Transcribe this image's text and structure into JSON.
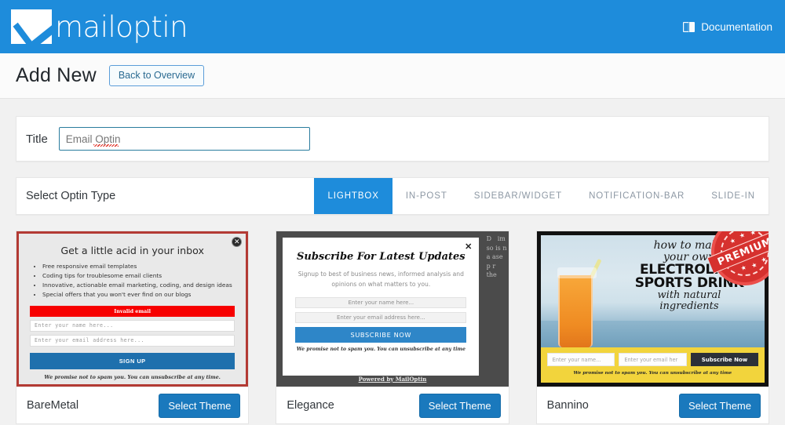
{
  "topbar": {
    "brand_name": "mailoptin",
    "brand_icon": "envelope-check-icon",
    "doc_icon": "book-icon",
    "doc_label": "Documentation",
    "bg_color": "#1e8cdb"
  },
  "pagehead": {
    "title": "Add New",
    "back_button": "Back to Overview"
  },
  "title_panel": {
    "label": "Title",
    "value": "Email Optin",
    "placeholder": "Email Optin"
  },
  "type_panel": {
    "label": "Select Optin Type",
    "tabs": [
      {
        "label": "LIGHTBOX",
        "active": true
      },
      {
        "label": "IN-POST",
        "active": false
      },
      {
        "label": "SIDEBAR/WIDGET",
        "active": false
      },
      {
        "label": "NOTIFICATION-BAR",
        "active": false
      },
      {
        "label": "SLIDE-IN",
        "active": false
      }
    ],
    "active_color": "#1e8cdb"
  },
  "themes": [
    {
      "name": "BareMetal",
      "select_label": "Select Theme",
      "premium": false,
      "preview": {
        "close_icon": "close-circle-icon",
        "headline": "Get a little acid in your inbox",
        "bullets": [
          "Free responsive email templates",
          "Coding tips for troublesome email clients",
          "Innovative, actionable email marketing, coding, and design ideas",
          "Special offers that you won't ever find on our blogs"
        ],
        "error": "Invalid email",
        "name_placeholder": "Enter your name here...",
        "email_placeholder": "Enter your email address here...",
        "button": "SIGN UP",
        "note": "We promise not to spam you. You can unsubscribe at any time."
      }
    },
    {
      "name": "Elegance",
      "select_label": "Select Theme",
      "premium": false,
      "preview": {
        "close_icon": "close-icon",
        "headline": "Subscribe For Latest Updates",
        "subhead": "Signup to best of business news, informed analysis and opinions on what matters to you.",
        "name_placeholder": "Enter your name here...",
        "email_placeholder": "Enter your email address here...",
        "button": "SUBSCRIBE NOW",
        "note": "We promise not to spam you. You can unsubscribe at any time",
        "powered_by": "Powered by MailOptin"
      }
    },
    {
      "name": "Bannino",
      "select_label": "Select Theme",
      "premium": true,
      "premium_label": "PREMIUM",
      "preview": {
        "script_line1": "how to make",
        "script_line2": "your own",
        "bold_line1": "ELECTROLYTE",
        "bold_line2": "SPORTS DRINK",
        "script_line3": "with natural",
        "script_line4": "ingredients",
        "name_placeholder": "Enter your name...",
        "email_placeholder": "Enter your email her",
        "button": "Subscribe Now",
        "note": "We promise not to spam you. You can unsubscribe at any time"
      }
    }
  ]
}
